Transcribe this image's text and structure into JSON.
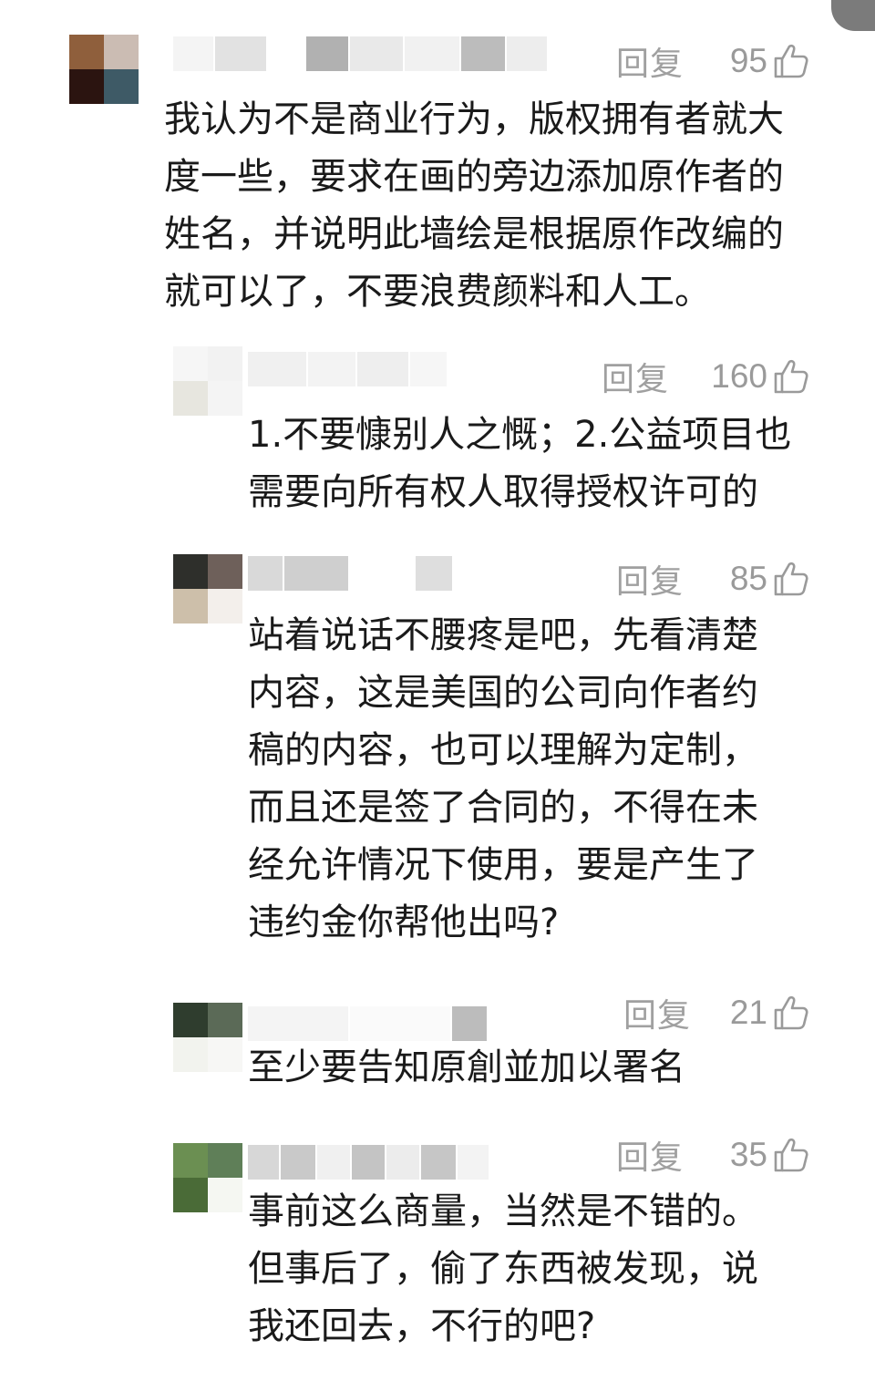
{
  "ui": {
    "reply_label": "回复",
    "like_icon": "thumbs-up-outline-icon"
  },
  "comments": [
    {
      "likes": "95",
      "text": "我认为不是商业行为，版权拥有者就大\n度一些，要求在画的旁边添加原作者的\n姓名，并说明此墙绘是根据原作改编的\n就可以了，不要浪费颜料和人工。"
    },
    {
      "likes": "160",
      "text": "1.不要慷别人之慨；2.公益项目也\n需要向所有权人取得授权许可的"
    },
    {
      "likes": "85",
      "text": "站着说话不腰疼是吧，先看清楚\n内容，这是美国的公司向作者约\n稿的内容，也可以理解为定制，\n而且还是签了合同的，不得在未\n经允许情况下使用，要是产生了\n违约金你帮他出吗?"
    },
    {
      "likes": "21",
      "text": "至少要告知原創並加以署名"
    },
    {
      "likes": "35",
      "text": "事前这么商量，当然是不错的。\n但事后了，偷了东西被发现，说\n我还回去，不行的吧?"
    }
  ],
  "colors": {
    "text": "#1a1a1a",
    "meta": "#9a9a9a",
    "background": "#ffffff"
  }
}
